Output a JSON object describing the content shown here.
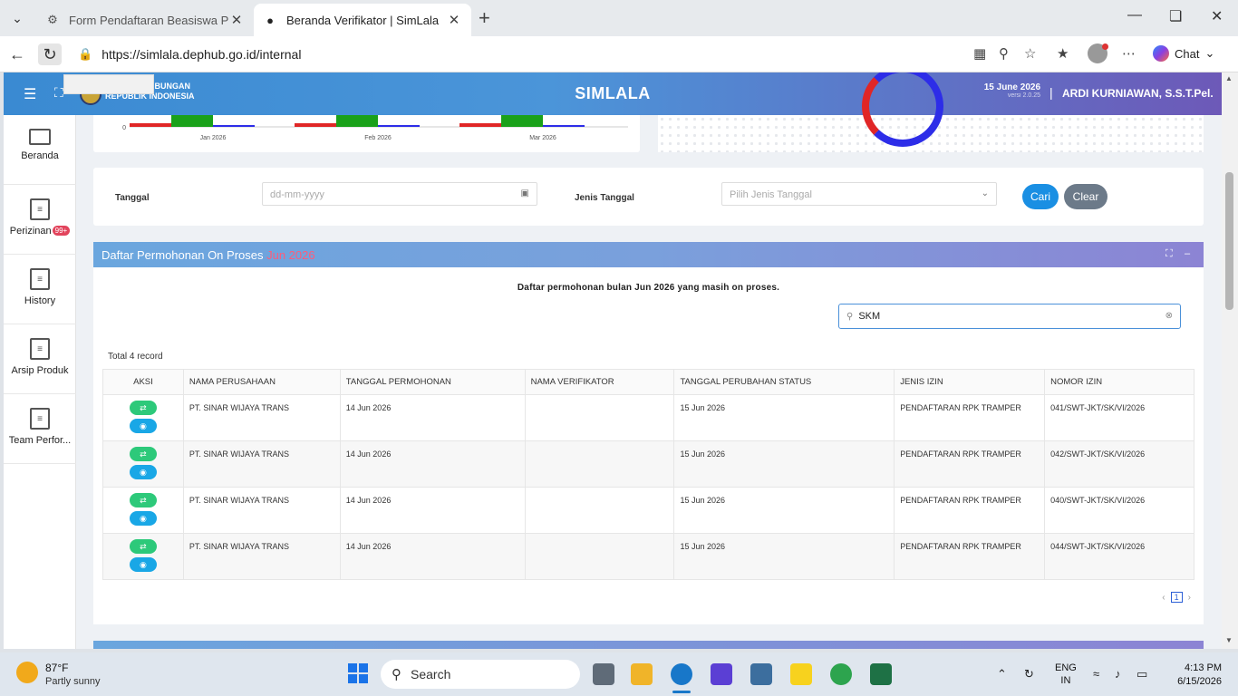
{
  "browser": {
    "tabs": [
      {
        "title": "Form Pendaftaran Beasiswa Program",
        "active": false
      },
      {
        "title": "Beranda Verifikator | SimLala",
        "active": true
      }
    ],
    "url": "https://simlala.dephub.go.id/internal",
    "chat_label": "Chat"
  },
  "header": {
    "ministry_line1": "...AN PERHUBUNGAN",
    "ministry_line2": "REPUBLIK INDONESIA",
    "app_title": "SIMLALA",
    "date": "15 June 2026",
    "version": "versi 2.0.25",
    "separator": "|",
    "user": "ARDI KURNIAWAN, S.S.T.Pel."
  },
  "sidebar": {
    "items": [
      {
        "label": "Beranda",
        "icon": "monitor-icon"
      },
      {
        "label": "Perizinan",
        "icon": "document-icon",
        "badge": "99+"
      },
      {
        "label": "History",
        "icon": "document-icon"
      },
      {
        "label": "Arsip Produk",
        "icon": "document-icon"
      },
      {
        "label": "Team Perfor...",
        "icon": "document-icon"
      }
    ]
  },
  "chart_data": {
    "type": "bar",
    "categories": [
      "Jan 2026",
      "Feb 2026",
      "Mar 2026"
    ],
    "y_tick_shown": "0",
    "series_colors": [
      "#e02626",
      "#1aa11a",
      "#2d2de8"
    ]
  },
  "filter": {
    "tanggal_label": "Tanggal",
    "tanggal_placeholder": "dd-mm-yyyy",
    "jenis_label": "Jenis Tanggal",
    "jenis_placeholder": "Pilih Jenis Tanggal",
    "cari_label": "Cari",
    "clear_label": "Clear"
  },
  "list": {
    "title": "Daftar Permohonan On Proses",
    "title_month": "Jun 2026",
    "description": "Daftar permohonan bulan Jun 2026 yang masih on proses.",
    "search_value": "SKM",
    "total": "Total 4 record",
    "columns": [
      "AKSI",
      "NAMA PERUSAHAAN",
      "TANGGAL PERMOHONAN",
      "NAMA VERIFIKATOR",
      "TANGGAL PERUBAHAN STATUS",
      "JENIS IZIN",
      "NOMOR IZIN"
    ],
    "rows": [
      {
        "perusahaan": "PT. SINAR WIJAYA TRANS",
        "tgl_permohonan": "14 Jun 2026",
        "verifikator": "",
        "tgl_status": "15 Jun 2026",
        "jenis": "PENDAFTARAN RPK TRAMPER",
        "nomor": "041/SWT-JKT/SK/VI/2026"
      },
      {
        "perusahaan": "PT. SINAR WIJAYA TRANS",
        "tgl_permohonan": "14 Jun 2026",
        "verifikator": "",
        "tgl_status": "15 Jun 2026",
        "jenis": "PENDAFTARAN RPK TRAMPER",
        "nomor": "042/SWT-JKT/SK/VI/2026"
      },
      {
        "perusahaan": "PT. SINAR WIJAYA TRANS",
        "tgl_permohonan": "14 Jun 2026",
        "verifikator": "",
        "tgl_status": "15 Jun 2026",
        "jenis": "PENDAFTARAN RPK TRAMPER",
        "nomor": "040/SWT-JKT/SK/VI/2026"
      },
      {
        "perusahaan": "PT. SINAR WIJAYA TRANS",
        "tgl_permohonan": "14 Jun 2026",
        "verifikator": "",
        "tgl_status": "15 Jun 2026",
        "jenis": "PENDAFTARAN RPK TRAMPER",
        "nomor": "044/SWT-JKT/SK/VI/2026"
      }
    ],
    "page": "1"
  },
  "taskbar": {
    "temp": "87°F",
    "weather": "Partly sunny",
    "search": "Search",
    "lang1": "ENG",
    "lang2": "IN",
    "time": "4:13 PM",
    "date": "6/15/2026"
  }
}
